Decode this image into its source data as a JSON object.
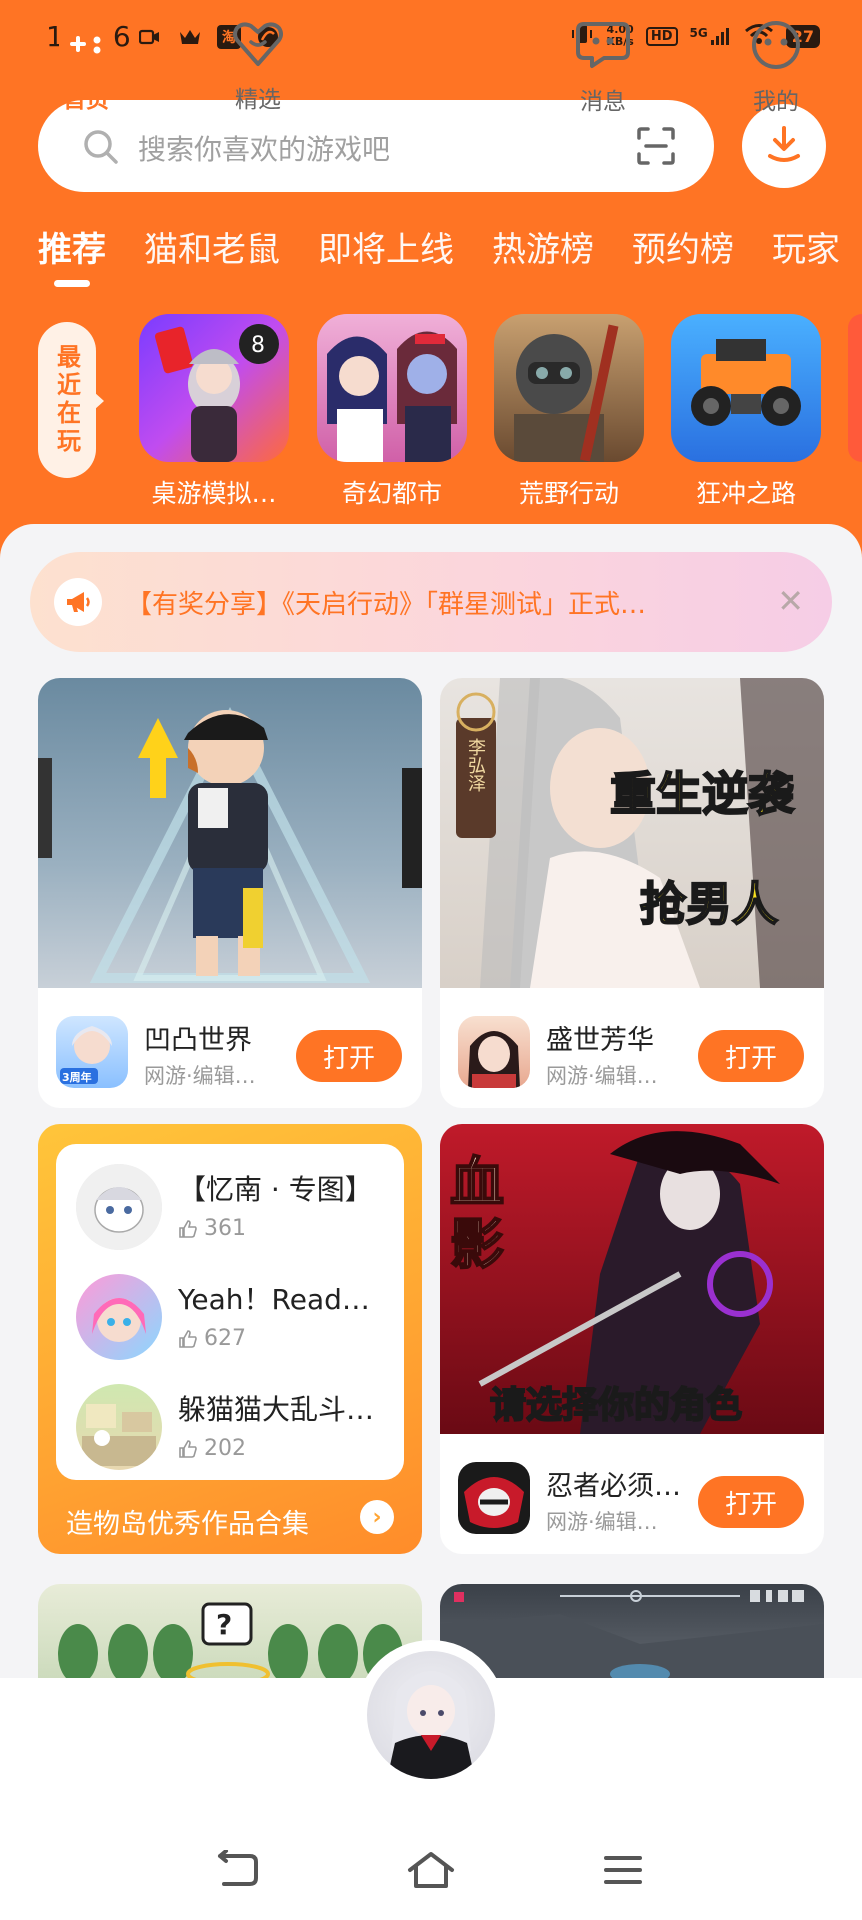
{
  "status_bar": {
    "time": "14:46",
    "taobao": "淘",
    "speed_value": "4.00",
    "speed_unit": "KB/s",
    "hd": "HD",
    "network": "5G",
    "battery": "27"
  },
  "search": {
    "placeholder": "搜索你喜欢的游戏吧",
    "icon": "search-icon",
    "scan_icon": "scan-icon",
    "download_icon": "download-icon"
  },
  "tabs": [
    "推荐",
    "猫和老鼠",
    "即将上线",
    "热游榜",
    "预约榜",
    "玩家"
  ],
  "recent": {
    "label": "最近在玩",
    "games": [
      "桌游模拟…",
      "奇幻都市",
      "荒野行动",
      "狂冲之路"
    ]
  },
  "notice": {
    "text": "【有奖分享】《天启行动》「群星测试」正式…",
    "icon": "megaphone-icon"
  },
  "cards": [
    {
      "title": "凹凸世界",
      "sub": "网游·编辑…",
      "button": "打开",
      "badge": "3周年"
    },
    {
      "title": "盛世芳华",
      "sub": "网游·编辑…",
      "button": "打开",
      "overlay1": "重生逆袭",
      "overlay2": "抢男人",
      "tag": "李弘泽"
    },
    {
      "title": "忍者必须…",
      "sub": "网游·编辑…",
      "button": "打开",
      "overlay1": "血影",
      "overlay2": "请选择你的角色"
    }
  ],
  "collection": {
    "items": [
      {
        "title": "【忆南 · 专图】",
        "likes": "361"
      },
      {
        "title": "Yeah！Read…",
        "likes": "627"
      },
      {
        "title": "躲猫猫大乱斗…",
        "likes": "202"
      }
    ],
    "footer": "造物岛优秀作品合集"
  },
  "bottom_nav": [
    {
      "label": "首页",
      "icon": "gamepad-icon",
      "active": true
    },
    {
      "label": "精选",
      "icon": "heart-icon",
      "active": false
    },
    {
      "label": "消息",
      "icon": "message-icon",
      "active": false
    },
    {
      "label": "我的",
      "icon": "profile-icon",
      "active": false
    }
  ],
  "colors": {
    "accent": "#ff7424",
    "background": "#f4f4f6"
  }
}
